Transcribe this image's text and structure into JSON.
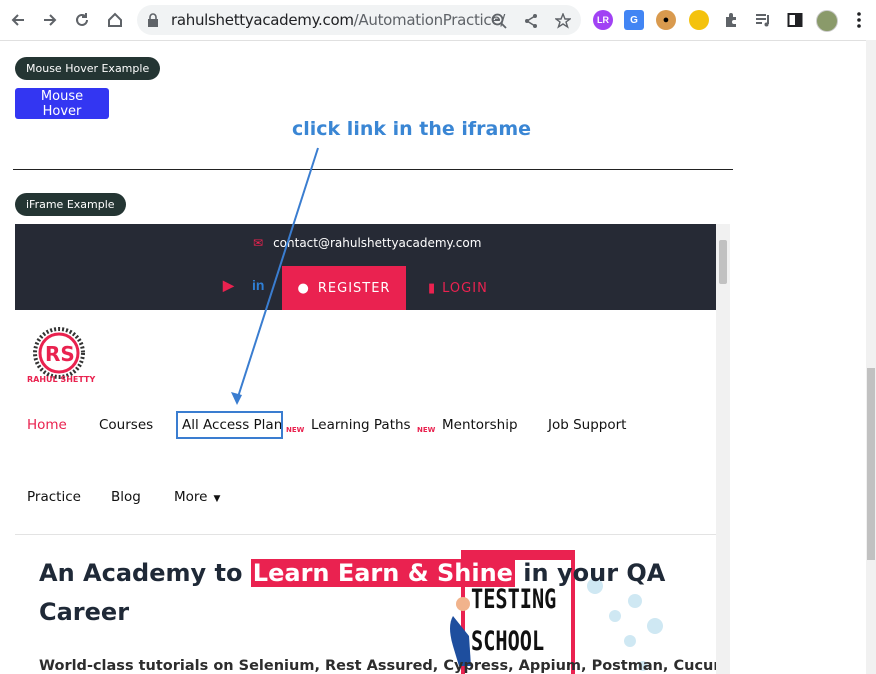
{
  "browser": {
    "url_host": "rahulshettyacademy.com",
    "url_path": "/AutomationPractice/",
    "icons": [
      "back-icon",
      "forward-icon",
      "reload-icon",
      "home-icon",
      "lock-icon",
      "zoom-icon",
      "share-icon",
      "star-icon",
      "puzzle-icon",
      "playlist-icon",
      "sidebar-icon",
      "avatar",
      "menu-dots-icon"
    ]
  },
  "page": {
    "mouse_hover_label": "Mouse Hover Example",
    "mouse_hover_button": "Mouse Hover",
    "iframe_label": "iFrame Example",
    "annotation": "click link in the iframe"
  },
  "iframe": {
    "email": "contact@rahulshettyacademy.com",
    "register": "REGISTER",
    "login": "LOGIN",
    "logo_text": "RAHUL SHETTY",
    "nav": {
      "home": "Home",
      "courses": "Courses",
      "all_access": "All Access Plan",
      "learning_paths": "Learning Paths",
      "mentorship": "Mentorship",
      "job_support": "Job Support",
      "practice": "Practice",
      "blog": "Blog",
      "more": "More",
      "new_tag": "NEW"
    },
    "hero": {
      "pre": "An Academy to",
      "highlight": "Learn Earn & Shine",
      "post": " in your QA Career"
    },
    "subtitle": "World-class tutorials on Selenium, Rest Assured, Cypress, Appium, Postman, Cucumber,",
    "graphic_text": [
      "TESTING",
      "SCHOOL"
    ]
  },
  "colors": {
    "accent": "#ea2250",
    "dark": "#262a35",
    "annotation": "#3a86d4"
  }
}
